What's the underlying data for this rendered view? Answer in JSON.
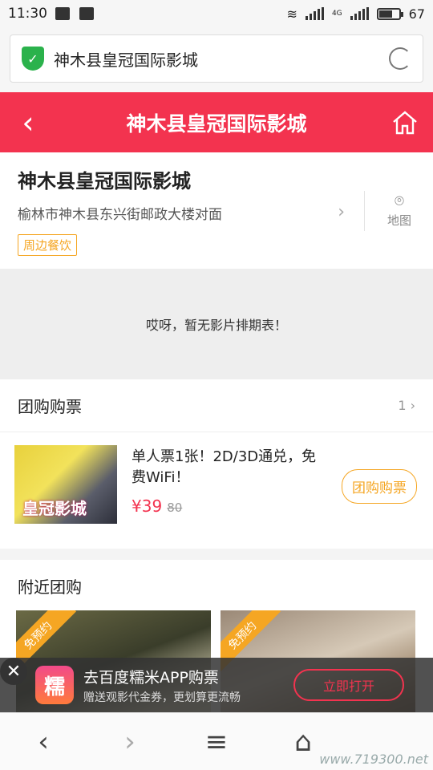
{
  "status": {
    "time": "11:30",
    "network": "4G",
    "battery": "67"
  },
  "browser": {
    "url_title": "神木县皇冠国际影城"
  },
  "header": {
    "title": "神木县皇冠国际影城"
  },
  "cinema": {
    "name": "神木县皇冠国际影城",
    "address": "榆林市神木县东兴街邮政大楼对面",
    "map_label": "地图",
    "tag": "周边餐饮"
  },
  "schedule": {
    "empty_text": "哎呀，暂无影片排期表！"
  },
  "group": {
    "title": "团购购票",
    "count": "1",
    "deal": {
      "poster_text": "皇冠影城",
      "desc": "单人票1张！2D/3D通兑，免费WiFi！",
      "price": "¥39",
      "orig_price": "80",
      "button": "团购购票"
    }
  },
  "nearby": {
    "title": "附近团购",
    "items": [
      {
        "ribbon": "免预约"
      },
      {
        "ribbon": "免预约"
      }
    ]
  },
  "banner": {
    "close": "✕",
    "logo": "糯",
    "line1": "去百度糯米APP购票",
    "line2": "赠送观影代金券，更划算更流畅",
    "button": "立即打开"
  },
  "nav": {
    "back": "‹",
    "forward": "›",
    "menu": "≡",
    "home": "⌂"
  },
  "watermark": "www.719300.net",
  "colors": {
    "accent": "#f3334f",
    "orange": "#f5a623",
    "green": "#2bb24c"
  }
}
